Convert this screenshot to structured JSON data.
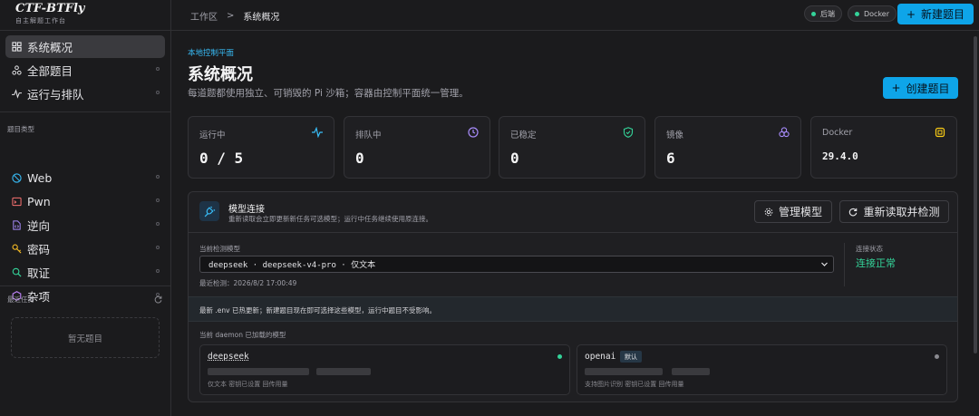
{
  "brand": {
    "title": "CTF-BTFly",
    "subtitle": "自主解题工作台"
  },
  "sidebar": {
    "nav": [
      {
        "label": "系统概况",
        "icon": "dashboard-icon",
        "active": true
      },
      {
        "label": "全部题目",
        "icon": "nodes-icon"
      },
      {
        "label": "运行与排队",
        "icon": "activity-icon"
      }
    ],
    "categories_title": "题目类型",
    "categories": [
      {
        "label": "Web",
        "icon": "web-icon",
        "color": "#38bdf8"
      },
      {
        "label": "Pwn",
        "icon": "terminal-icon",
        "color": "#f87171"
      },
      {
        "label": "逆向",
        "icon": "code-file-icon",
        "color": "#a78bfa"
      },
      {
        "label": "密码",
        "icon": "key-icon",
        "color": "#fbbf24"
      },
      {
        "label": "取证",
        "icon": "search-icon",
        "color": "#34d399"
      },
      {
        "label": "杂项",
        "icon": "hexagon-icon",
        "color": "#c084fc"
      }
    ],
    "recent_title": "最近任务",
    "recent_empty": "暂无题目"
  },
  "topbar": {
    "breadcrumb": [
      "工作区",
      "系统概况"
    ],
    "separator": ">",
    "status_pills": [
      "后端",
      "Docker"
    ],
    "new_button": "新建题目"
  },
  "main": {
    "eyebrow": "本地控制平面",
    "title": "系统概况",
    "description": "每道题都使用独立、可销毁的 Pi 沙箱；容器由控制平面统一管理。",
    "create_button": "创建题目",
    "stats": [
      {
        "label": "运行中",
        "value": "0 / 5",
        "icon": "pulse-icon",
        "color": "#38bdf8"
      },
      {
        "label": "排队中",
        "value": "0",
        "icon": "clock-icon",
        "color": "#a78bfa"
      },
      {
        "label": "已稳定",
        "value": "0",
        "icon": "shield-check-icon",
        "color": "#34d399"
      },
      {
        "label": "镜像",
        "value": "6",
        "icon": "layers-icon",
        "color": "#a78bfa"
      },
      {
        "label": "Docker",
        "value": "29.4.0",
        "icon": "chip-icon",
        "color": "#facc15"
      }
    ],
    "model_panel": {
      "title": "模型连接",
      "subtitle": "重新读取会立即更新新任务可选模型；运行中任务继续使用原连接。",
      "manage_button": "管理模型",
      "recheck_button": "重新读取并检测",
      "current_label": "当前检测模型",
      "current_value": "deepseek · deepseek-v4-pro · 仅文本",
      "last_check": "最近检测：2026/8/2 17:00:49",
      "conn_label": "连接状态",
      "conn_value": "连接正常",
      "notice": "最新 .env 已热更新；新建题目现在即可选择这些模型，运行中题目不受影响。",
      "loaded_label": "当前 daemon 已加载的模型",
      "models": [
        {
          "name": "deepseek",
          "badge": "",
          "meta": "仅文本  密钥已设置  回传用量",
          "status_color": "#34d399"
        },
        {
          "name": "openai",
          "badge": "默认",
          "meta": "支持图片识别  密钥已设置  回传用量",
          "status_color": "#8a8a90"
        }
      ]
    }
  }
}
